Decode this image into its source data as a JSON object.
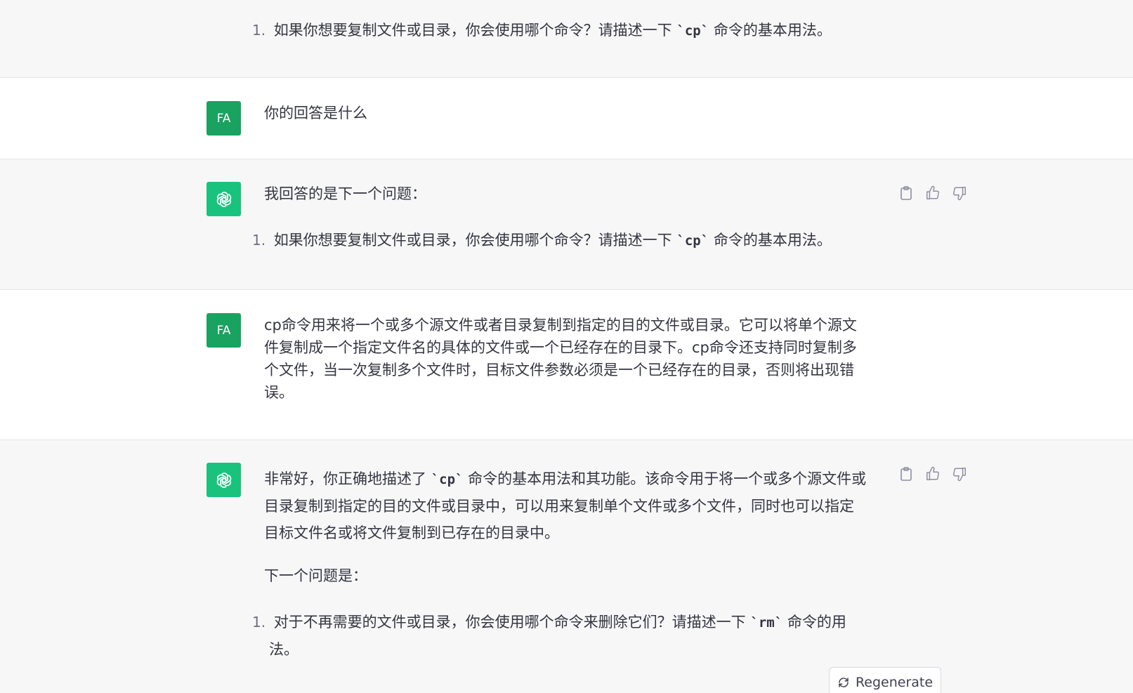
{
  "conversation": {
    "top_item": {
      "number": "1.",
      "before": "如果你想要复制文件或目录，你会使用哪个命令？请描述一下",
      "code": "`cp`",
      "after": "命令的基本用法。"
    },
    "user1": {
      "avatar": "FA",
      "text": "你的回答是什么"
    },
    "bot1": {
      "intro": "我回答的是下一个问题：",
      "item": {
        "number": "1.",
        "before": "如果你想要复制文件或目录，你会使用哪个命令？请描述一下",
        "code": "`cp`",
        "after": "命令的基本用法。"
      }
    },
    "user2": {
      "avatar": "FA",
      "line1": "cp命令用来将一个或多个源文件或者目录复制到指定的目的文件或目录。它可以将单个源文",
      "line2": "件复制成一个指定文件名的具体的文件或一个已经存在的目录下。cp命令还支持同时复制多",
      "line3": "个文件，当一次复制多个文件时，目标文件参数必须是一个已经存在的目录，否则将出现错",
      "line4": "误。"
    },
    "bot2": {
      "p1_before": "非常好，你正确地描述了",
      "p1_code": "`cp`",
      "p1_line1_after": "命令的基本用法和其功能。该命令用于将一个或多个源文件或",
      "p1_line2": "目录复制到指定的目的文件或目录中，可以用来复制单个文件或多个文件，同时也可以指定",
      "p1_line3": "目标文件名或将文件复制到已存在的目录中。",
      "p2": "下一个问题是：",
      "item": {
        "number": "1.",
        "before": "对于不再需要的文件或目录，你会使用哪个命令来删除它们？请描述一下",
        "code": "`rm`",
        "after": "命令的用",
        "line2": "法。"
      }
    }
  },
  "actions": {
    "copy_icon": "clipboard-icon",
    "like_icon": "thumbs-up-icon",
    "dislike_icon": "thumbs-down-icon"
  },
  "regenerate": {
    "label": "Regenerate",
    "icon": "refresh-icon"
  },
  "colors": {
    "gray_bg": "#f7f7f8",
    "user_avatar": "#1aa260",
    "bot_avatar": "#19c37d"
  }
}
